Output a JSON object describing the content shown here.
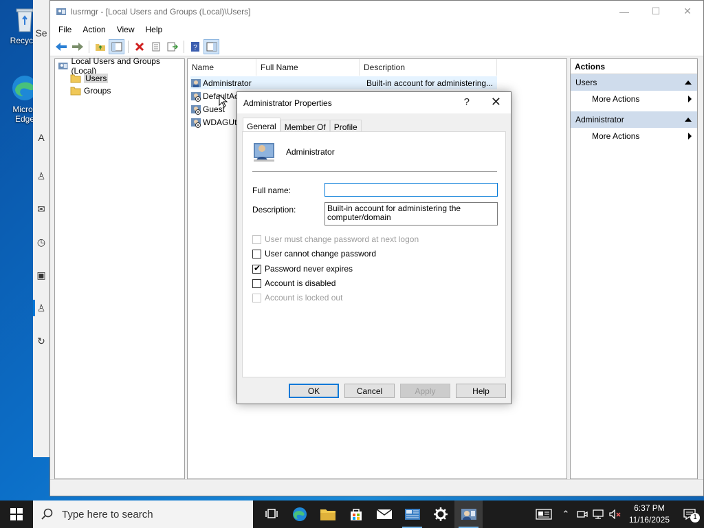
{
  "desktop": {
    "icons": [
      {
        "label": "Recycle",
        "icon": "recycle-bin-icon"
      },
      {
        "label": "Micros Edge",
        "icon": "edge-icon"
      }
    ],
    "accent": "#0c6fc8"
  },
  "window": {
    "title": "lusrmgr - [Local Users and Groups (Local)\\Users]",
    "menu": [
      "File",
      "Action",
      "View",
      "Help"
    ]
  },
  "tree": {
    "root": "Local Users and Groups (Local)",
    "items": [
      "Users",
      "Groups"
    ]
  },
  "list": {
    "columns": [
      "Name",
      "Full Name",
      "Description"
    ],
    "rows": [
      {
        "name": "Administrator",
        "full_name": "",
        "description": "Built-in account for administering..."
      },
      {
        "name": "DefaultAc",
        "full_name": "",
        "description": ""
      },
      {
        "name": "Guest",
        "full_name": "",
        "description": ""
      },
      {
        "name": "WDAGUti",
        "full_name": "",
        "description": ""
      }
    ]
  },
  "actions": {
    "header": "Actions",
    "sections": [
      {
        "title": "Users",
        "items": [
          "More Actions"
        ]
      },
      {
        "title": "Administrator",
        "items": [
          "More Actions"
        ]
      }
    ]
  },
  "dialog": {
    "title": "Administrator Properties",
    "help_glyph": "?",
    "tabs": [
      "General",
      "Member Of",
      "Profile"
    ],
    "user_name": "Administrator",
    "full_name_label": "Full name:",
    "full_name_value": "",
    "description_label": "Description:",
    "description_value": "Built-in account for administering the computer/domain",
    "checkboxes": [
      {
        "label": "User must change password at next logon",
        "checked": false,
        "disabled": true
      },
      {
        "label": "User cannot change password",
        "checked": false,
        "disabled": false
      },
      {
        "label": "Password never expires",
        "checked": true,
        "disabled": false
      },
      {
        "label": "Account is disabled",
        "checked": false,
        "disabled": false
      },
      {
        "label": "Account is locked out",
        "checked": false,
        "disabled": true
      }
    ],
    "buttons": [
      "OK",
      "Cancel",
      "Apply",
      "Help"
    ]
  },
  "taskbar": {
    "search_placeholder": "Type here to search",
    "time": "6:37 PM",
    "date": "11/16/2025",
    "notification_count": "1"
  }
}
